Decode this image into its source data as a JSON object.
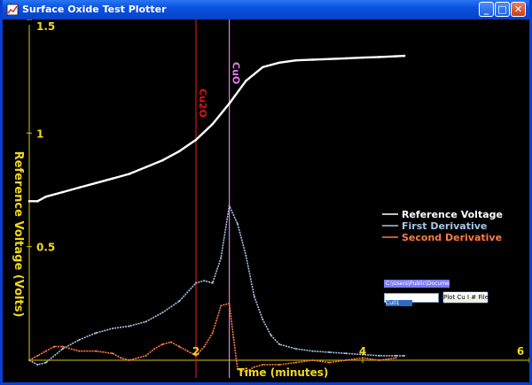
{
  "window": {
    "title": "Surface Oxide Test Plotter"
  },
  "controls": {
    "path_value": "C:\\Users\\Public\\Documents",
    "file_input_value": "Cu01",
    "plot_button_label": "Plot Cu I # File"
  },
  "colors": {
    "reference": "#ffffff",
    "first_derivative": "#a8c4e8",
    "second_derivative": "#ff7b40",
    "axis": "#d8c800",
    "cu2o_line": "#d41414",
    "cuo_line": "#e27be8",
    "label_yellow": "#f0d81c"
  },
  "chart_data": {
    "type": "line",
    "ylabel": "Reference Voltage (Volts)",
    "xlabel": "Time (minutes)",
    "y_ticks": [
      "1.5",
      "1",
      "0.5"
    ],
    "x_ticks": [
      "2",
      "4",
      "6"
    ],
    "ylim": [
      0,
      1.5
    ],
    "xlim": [
      0,
      6
    ],
    "grid": false,
    "legend_position": "right",
    "markers": [
      {
        "label": "Cu2O",
        "x": 2.0
      },
      {
        "label": "CuO",
        "x": 2.4
      }
    ],
    "series": [
      {
        "name": "Reference Voltage",
        "x": [
          0.0,
          0.1,
          0.2,
          0.4,
          0.6,
          0.8,
          1.0,
          1.2,
          1.4,
          1.6,
          1.8,
          2.0,
          2.2,
          2.4,
          2.6,
          2.8,
          3.0,
          3.2,
          3.4,
          3.6,
          3.8,
          4.0,
          4.2,
          4.4,
          4.5
        ],
        "values": [
          0.7,
          0.7,
          0.72,
          0.74,
          0.76,
          0.78,
          0.8,
          0.82,
          0.85,
          0.88,
          0.92,
          0.97,
          1.04,
          1.13,
          1.23,
          1.29,
          1.31,
          1.32,
          1.323,
          1.326,
          1.329,
          1.332,
          1.335,
          1.338,
          1.34
        ]
      },
      {
        "name": "First Derivative",
        "x": [
          0.0,
          0.1,
          0.2,
          0.4,
          0.6,
          0.8,
          1.0,
          1.2,
          1.4,
          1.6,
          1.8,
          2.0,
          2.1,
          2.2,
          2.3,
          2.4,
          2.5,
          2.6,
          2.7,
          2.8,
          2.9,
          3.0,
          3.2,
          3.4,
          3.6,
          3.8,
          4.0,
          4.2,
          4.4,
          4.5
        ],
        "values": [
          0.0,
          -0.02,
          -0.01,
          0.05,
          0.09,
          0.12,
          0.14,
          0.15,
          0.17,
          0.21,
          0.26,
          0.34,
          0.35,
          0.34,
          0.45,
          0.68,
          0.6,
          0.46,
          0.28,
          0.18,
          0.11,
          0.07,
          0.05,
          0.04,
          0.035,
          0.03,
          0.025,
          0.02,
          0.02,
          0.02
        ]
      },
      {
        "name": "Second Derivative",
        "x": [
          0.0,
          0.1,
          0.2,
          0.3,
          0.4,
          0.6,
          0.8,
          1.0,
          1.1,
          1.2,
          1.4,
          1.5,
          1.6,
          1.7,
          1.8,
          1.9,
          2.0,
          2.1,
          2.2,
          2.3,
          2.4,
          2.45,
          2.5,
          2.6,
          2.7,
          2.8,
          3.0,
          3.2,
          3.4,
          3.6,
          3.8,
          4.0,
          4.2,
          4.4
        ],
        "values": [
          0.0,
          0.02,
          0.04,
          0.06,
          0.06,
          0.04,
          0.04,
          0.03,
          0.01,
          0.0,
          0.02,
          0.05,
          0.07,
          0.08,
          0.06,
          0.04,
          0.02,
          0.06,
          0.12,
          0.24,
          0.25,
          0.1,
          -0.04,
          -0.05,
          -0.03,
          -0.02,
          -0.02,
          -0.01,
          0.0,
          -0.01,
          0.0,
          0.01,
          0.0,
          0.01
        ]
      }
    ]
  }
}
